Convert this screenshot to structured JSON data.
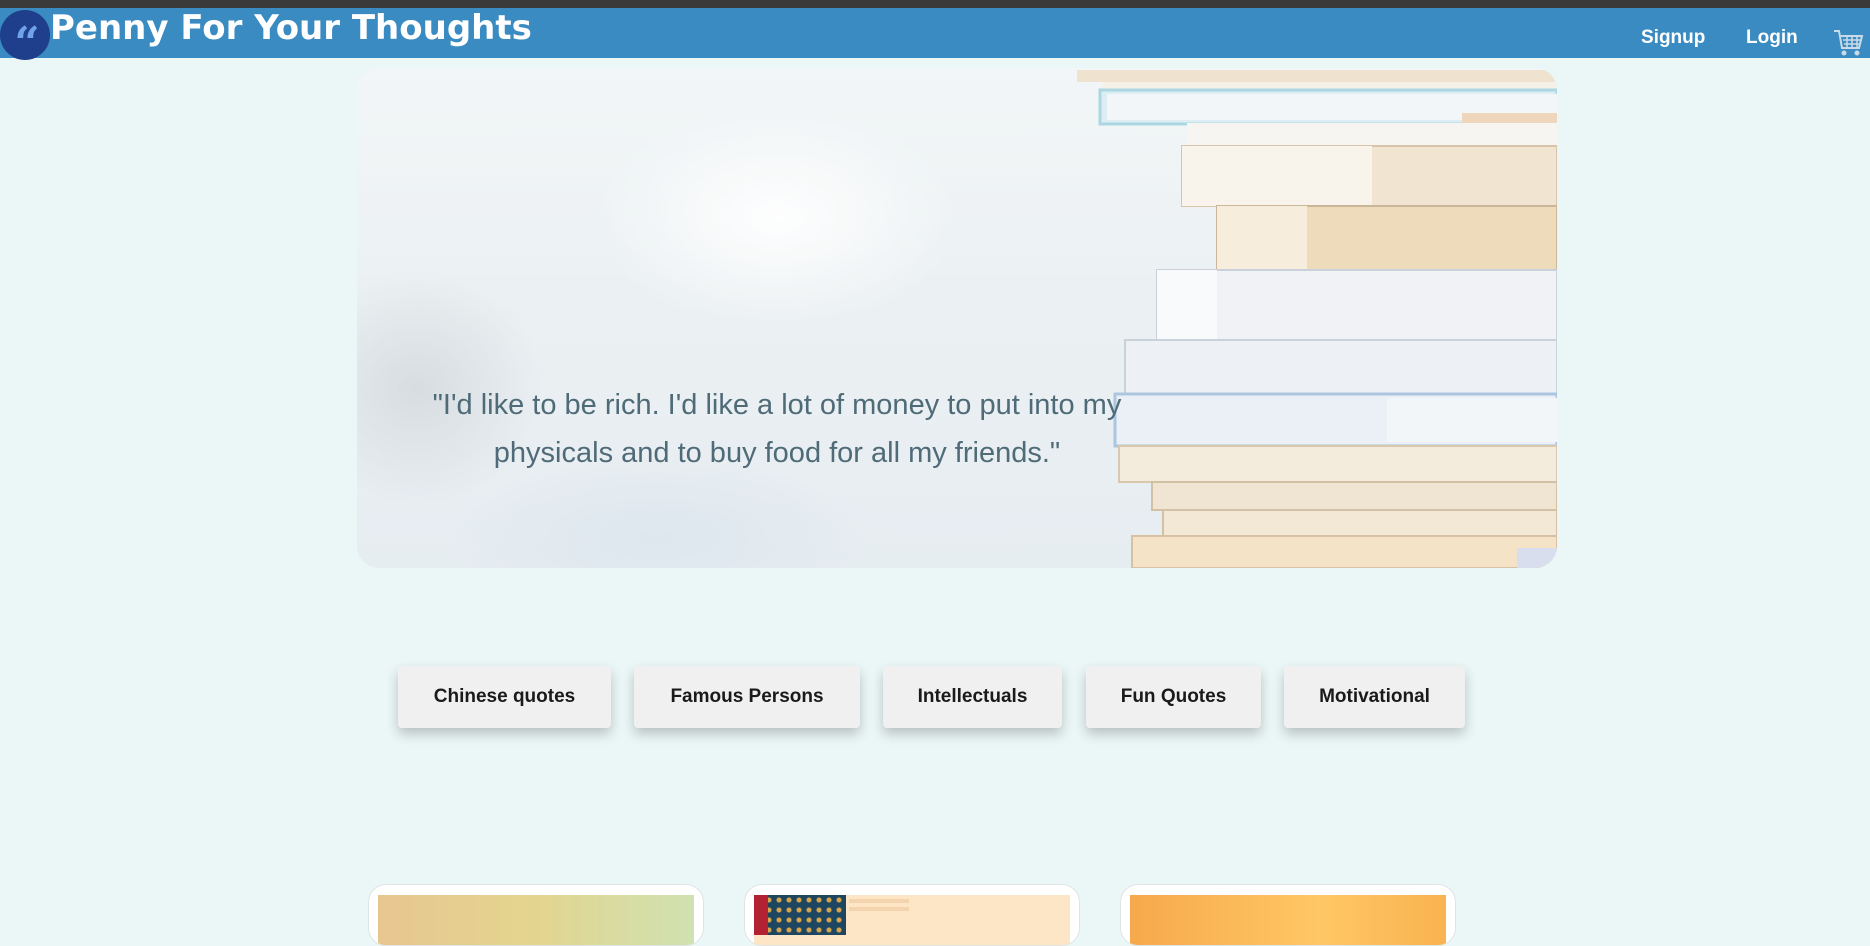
{
  "header": {
    "site_title": "Penny For Your Thoughts",
    "logo_icon": "quote-marks-icon",
    "signup_label": "Signup",
    "login_label": "Login",
    "cart_icon": "shopping-cart-icon"
  },
  "hero": {
    "quote_line_1": "\"I'd like to be rich. I'd like a lot of money to put into my",
    "quote_line_2": "physicals and to buy food for all my friends.\""
  },
  "categories": [
    {
      "label": "Chinese quotes"
    },
    {
      "label": "Famous Persons"
    },
    {
      "label": "Intellectuals"
    },
    {
      "label": "Fun Quotes"
    },
    {
      "label": "Motivational"
    }
  ],
  "colors": {
    "navbar": "#3a8bc2",
    "page_background": "#ebf7f7",
    "logo_circle": "#1f3f8c",
    "quote_text": "#4f6b78"
  }
}
